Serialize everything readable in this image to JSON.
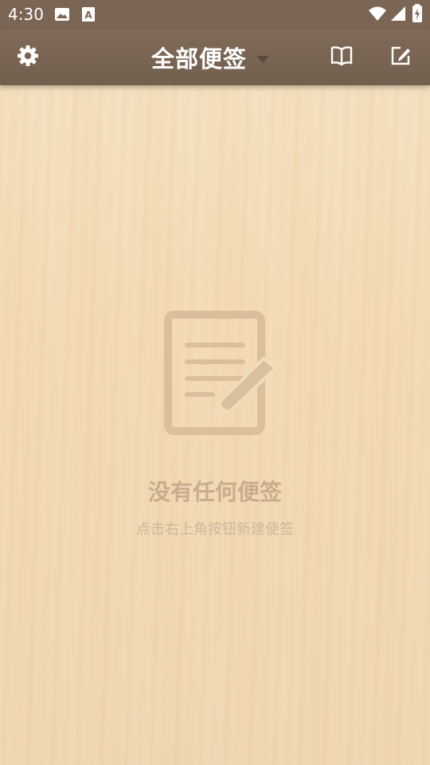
{
  "status_bar": {
    "time": "4:30",
    "icons": [
      "image-icon",
      "text-icon",
      "wifi-icon",
      "signal-icon",
      "battery-icon"
    ]
  },
  "toolbar": {
    "title": "全部便签",
    "settings_icon": "gear-icon",
    "book_icon": "book-icon",
    "new_note_icon": "edit-icon"
  },
  "empty_state": {
    "title": "没有任何便签",
    "hint": "点击右上角按钮新建便签"
  },
  "colors": {
    "status_bar": "#7b6655",
    "toolbar": "#7a6452",
    "background": "#f3dfbf",
    "empty_text": "#c7ad8d"
  }
}
